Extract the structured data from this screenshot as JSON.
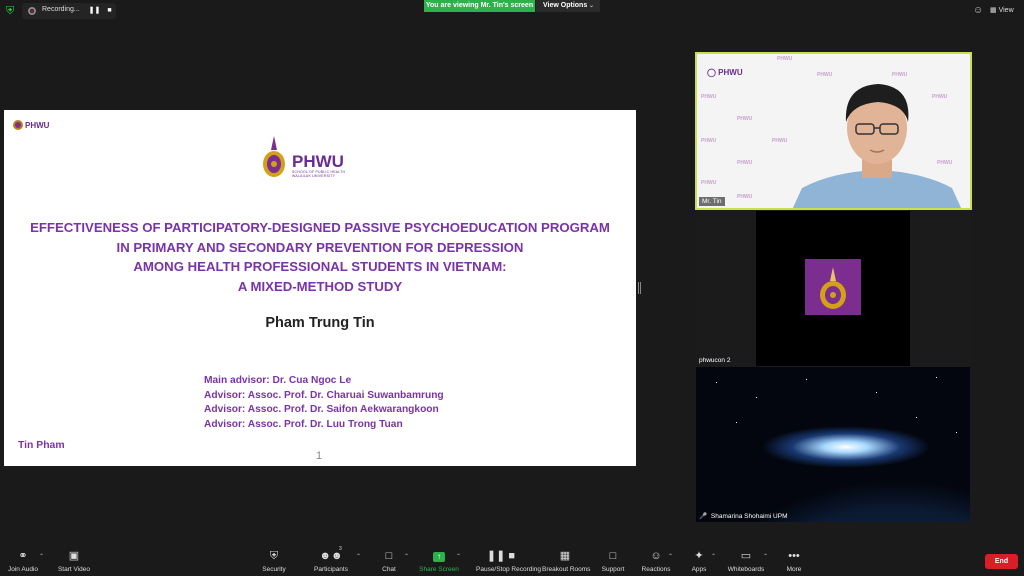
{
  "topbar": {
    "recording_label": "Recording...",
    "pause_icon": "pause-icon",
    "stop_icon": "stop-icon",
    "viewing_banner": "You are viewing Mr. Tin's screen",
    "view_options": "View Options",
    "view_label": "View"
  },
  "slide": {
    "logo_text": "PHWU",
    "logo_sub1": "SCHOOL OF PUBLIC HEALTH",
    "logo_sub2": "WALAILAK UNIVERSITY",
    "title_lines": [
      "EFFECTIVENESS OF PARTICIPATORY-DESIGNED PASSIVE PSYCHOEDUCATION PROGRAM",
      "IN PRIMARY AND SECONDARY PREVENTION FOR DEPRESSION",
      "AMONG HEALTH PROFESSIONAL  STUDENTS IN VIETNAM:",
      "A MIXED-METHOD STUDY"
    ],
    "author": "Pham Trung Tin",
    "advisors": [
      "Main advisor: Dr. Cua Ngoc Le",
      "Advisor: Assoc. Prof. Dr. Charuai Suwanbamrung",
      "Advisor: Assoc. Prof. Dr. Saifon Aekwarangkoon",
      "Advisor: Assoc. Prof. Dr. Luu Trong Tuan"
    ],
    "footer_name": "Tin Pham",
    "page_number": "1"
  },
  "participants": [
    {
      "name": "Mr. Tin"
    },
    {
      "name": "phwucon 2"
    },
    {
      "name": "Shamarina Shohaimi UPM"
    }
  ],
  "toolbar": {
    "join_audio": "Join Audio",
    "start_video": "Start Video",
    "security": "Security",
    "participants": "Participants",
    "participants_count": "3",
    "chat": "Chat",
    "share_screen": "Share Screen",
    "pause_stop_recording": "Pause/Stop Recording",
    "breakout_rooms": "Breakout Rooms",
    "support": "Support",
    "reactions": "Reactions",
    "apps": "Apps",
    "whiteboards": "Whiteboards",
    "more": "More",
    "end": "End"
  },
  "colors": {
    "accent_green": "#2db24b",
    "slide_purple": "#7a33a8",
    "end_red": "#d81f26",
    "active_speaker": "#c9e04a"
  }
}
